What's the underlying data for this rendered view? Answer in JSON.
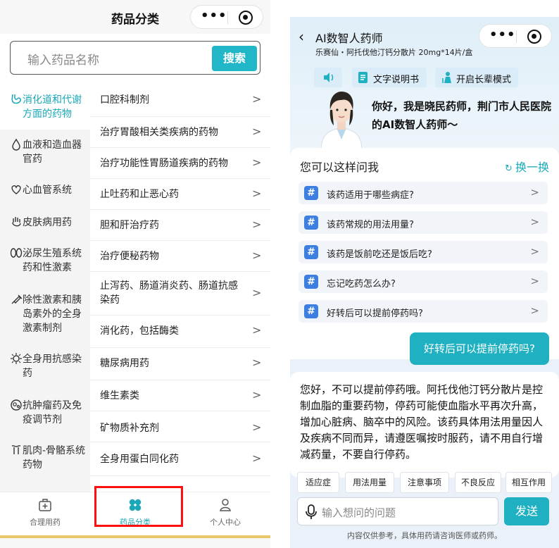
{
  "left": {
    "header": {
      "title": "药品分类"
    },
    "search": {
      "placeholder": "输入药品名称",
      "button": "搜索"
    },
    "categories": [
      {
        "label": "消化道和代谢方面的药物",
        "icon": "stomach-icon",
        "active": true
      },
      {
        "label": "血液和造血器官药",
        "icon": "blood-drop-icon"
      },
      {
        "label": "心血管系统",
        "icon": "heart-icon"
      },
      {
        "label": "皮肤病用药",
        "icon": "hand-icon"
      },
      {
        "label": "泌尿生殖系统药和性激素",
        "icon": "kidney-icon"
      },
      {
        "label": "除性激素和胰岛素外的全身激素制剂",
        "icon": "syringe-icon"
      },
      {
        "label": "全身用抗感染药",
        "icon": "virus-icon"
      },
      {
        "label": "抗肿瘤药及免疫调节剂",
        "icon": "cell-icon"
      },
      {
        "label": "肌肉-骨骼系统药物",
        "icon": "bone-icon"
      }
    ],
    "items": [
      "口腔科制剂",
      "治疗胃酸相关类疾病的药物",
      "治疗功能性胃肠道疾病的药物",
      "止吐药和止恶心药",
      "胆和肝治疗药",
      "治疗便秘药物",
      "止泻药、肠道消炎药、肠道抗感染药",
      "消化药，包括酶类",
      "糖尿病用药",
      "维生素类",
      "矿物质补充剂",
      "全身用蛋白同化药"
    ],
    "tabbar": [
      {
        "label": "合理用药",
        "icon": "medicine-box-icon"
      },
      {
        "label": "药品分类",
        "icon": "clover-icon",
        "active": true
      },
      {
        "label": "个人中心",
        "icon": "person-icon"
      }
    ],
    "colors": {
      "accent": "#1aa8b8",
      "highlight": "#ff1010"
    }
  },
  "right": {
    "header": {
      "back": "‹",
      "title": "AI数智人药师",
      "subtitle": "乐赛仙・阿托伐他汀钙分散片 20mg*14片/盒"
    },
    "buttons": {
      "instructions": "文字说明书",
      "elder_mode": "开启长辈模式"
    },
    "greeting": "你好，我是晓民药师，荆门市人民医院的AI数智人药师～",
    "ask": {
      "title": "您可以这样问我",
      "refresh": "换一换"
    },
    "questions": [
      "该药适用于哪些病症?",
      "该药常规的用法用量?",
      "该药是饭前吃还是饭后吃?",
      "忘记吃药怎么办?",
      "好转后可以提前停药吗?"
    ],
    "user_message": "好转后可以提前停药吗?",
    "answer": "您好，不可以提前停药哦。阿托伐他汀钙分散片是控制血脂的重要药物，停药可能使血脂水平再次升高，增加心脏病、脑卒中的风险。该药具体用法用量因人及疾病不同而异，请遵医嘱按时服药，请不用自行增减药量，不要自行停药。",
    "chips": [
      "适应症",
      "用法用量",
      "注意事项",
      "不良反应",
      "相互作用"
    ],
    "input": {
      "placeholder": "输入想问的问题",
      "send": "发送"
    },
    "disclaimer": "内容仅供参考，具体用药请咨询医师或药师。",
    "colors": {
      "accent": "#1fb1c2",
      "hash": "#3d7fe0"
    }
  }
}
